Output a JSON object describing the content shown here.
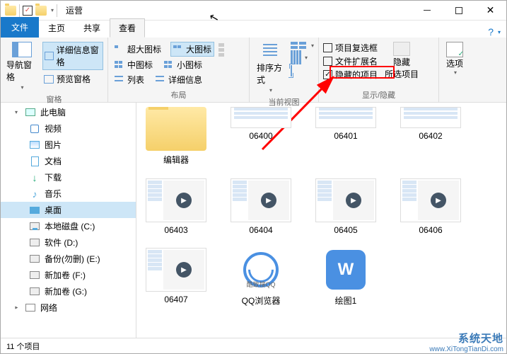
{
  "window": {
    "title": "运营"
  },
  "tabs": {
    "file": "文件",
    "home": "主页",
    "share": "共享",
    "view": "查看"
  },
  "ribbon": {
    "panes": {
      "nav": "导航窗格",
      "detail": "详细信息窗格",
      "preview": "预览窗格",
      "group": "窗格"
    },
    "layout": {
      "xlarge": "超大图标",
      "large": "大图标",
      "medium": "中图标",
      "small": "小图标",
      "list": "列表",
      "details": "详细信息",
      "group": "布局"
    },
    "view": {
      "sort": "排序方式",
      "groupby": "分组依据",
      "addcols": "添加列",
      "autofit": "将所有列调整为合适的大小",
      "group": "当前视图"
    },
    "show": {
      "checkboxes": "项目复选框",
      "extensions": "文件扩展名",
      "hidden": "隐藏的项目",
      "hidebtn": "隐藏",
      "hidebtn2": "所选项目",
      "group": "显示/隐藏"
    },
    "options": "选项"
  },
  "sidebar": {
    "pc": "此电脑",
    "video": "视频",
    "pictures": "图片",
    "documents": "文档",
    "downloads": "下载",
    "music": "音乐",
    "desktop": "桌面",
    "diskc": "本地磁盘 (C:)",
    "diskd": "软件 (D:)",
    "diske": "备份(勿删) (E:)",
    "diskf": "新加卷 (F:)",
    "diskg": "新加卷 (G:)",
    "network": "网络"
  },
  "files": [
    {
      "name": "编辑器",
      "type": "folder"
    },
    {
      "name": "06400",
      "type": "list"
    },
    {
      "name": "06401",
      "type": "list"
    },
    {
      "name": "06402",
      "type": "list"
    },
    {
      "name": "06403",
      "type": "app"
    },
    {
      "name": "06404",
      "type": "app"
    },
    {
      "name": "06405",
      "type": "app"
    },
    {
      "name": "06406",
      "type": "app"
    },
    {
      "name": "06407",
      "type": "app"
    },
    {
      "name": "QQ浏览器",
      "type": "qq"
    },
    {
      "name": "绘图1",
      "type": "wps"
    }
  ],
  "status": {
    "count": "11 个项目"
  },
  "watermark": {
    "main": "系统天地",
    "sub": "酷致搜QQ",
    "url": "www.XiTongTianDi.com"
  }
}
